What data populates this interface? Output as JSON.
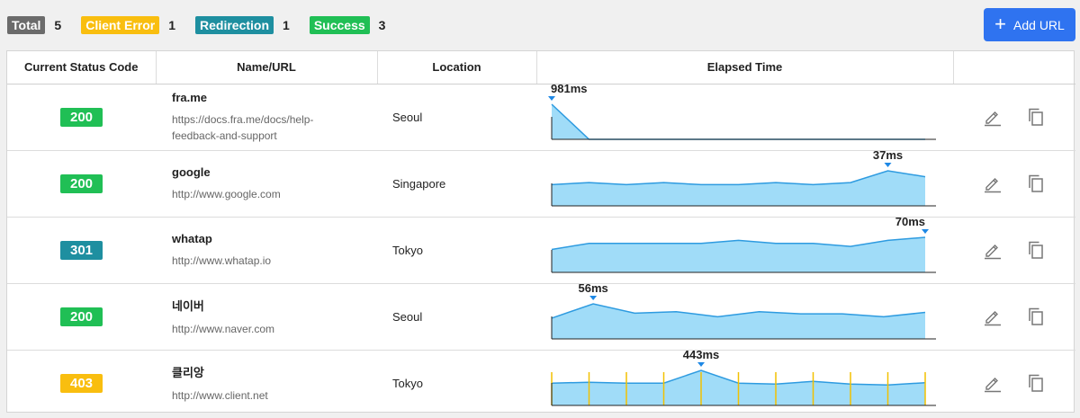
{
  "summary": [
    {
      "label": "Total",
      "count": "5",
      "color": "#6b6b6b"
    },
    {
      "label": "Client Error",
      "count": "1",
      "color": "#f9be0f"
    },
    {
      "label": "Redirection",
      "count": "1",
      "color": "#1e8fa0"
    },
    {
      "label": "Success",
      "count": "3",
      "color": "#20bf55"
    }
  ],
  "add_button": {
    "label": "Add URL",
    "icon": "plus-icon",
    "color": "#2f73f0"
  },
  "table": {
    "headers": [
      "Current Status Code",
      "Name/URL",
      "Location",
      "Elapsed Time",
      ""
    ],
    "rows": [
      {
        "code": "200",
        "code_color": "#20bf55",
        "name": "fra.me",
        "url": "https://docs.fra.me/docs/help-feedback-and-support",
        "location": "Seoul",
        "elapsed": {
          "values": [
            981,
            0,
            0,
            0,
            0,
            0,
            0,
            0,
            0,
            0,
            0
          ],
          "label": "981ms",
          "peak_index": 0,
          "markers": false
        }
      },
      {
        "code": "200",
        "code_color": "#20bf55",
        "name": "google",
        "url": "http://www.google.com",
        "location": "Singapore",
        "elapsed": {
          "values": [
            30,
            31,
            30,
            31,
            30,
            30,
            31,
            30,
            31,
            37,
            34
          ],
          "label": "37ms",
          "peak_index": 9,
          "markers": false
        }
      },
      {
        "code": "301",
        "code_color": "#1e8fa0",
        "name": "whatap",
        "url": "http://www.whatap.io",
        "location": "Tokyo",
        "elapsed": {
          "values": [
            68,
            69,
            69,
            69,
            69,
            69.5,
            69,
            69,
            68.5,
            69.5,
            70
          ],
          "label": "70ms",
          "peak_index": 10,
          "markers": false
        }
      },
      {
        "code": "200",
        "code_color": "#20bf55",
        "name": "네이버",
        "url": "http://www.naver.com",
        "location": "Seoul",
        "elapsed": {
          "values": [
            36,
            56,
            43,
            45,
            38,
            45,
            42,
            42,
            38,
            44
          ],
          "label": "56ms",
          "peak_index": 1,
          "markers": false
        }
      },
      {
        "code": "403",
        "code_color": "#f9be0f",
        "name": "클리앙",
        "url": "http://www.client.net",
        "location": "Tokyo",
        "elapsed": {
          "values": [
            300,
            310,
            300,
            300,
            443,
            300,
            290,
            320,
            290,
            280,
            305
          ],
          "label": "443ms",
          "peak_index": 4,
          "markers": true
        }
      }
    ]
  },
  "icons": {
    "edit": "edit-pencil-icon",
    "copy": "copy-icon"
  },
  "colors": {
    "area_fill": "#8fd6f7",
    "area_line": "#2e9be0",
    "peak_marker": "#1e88e5",
    "tick_marker": "#f2c100",
    "axis": "#222222"
  }
}
